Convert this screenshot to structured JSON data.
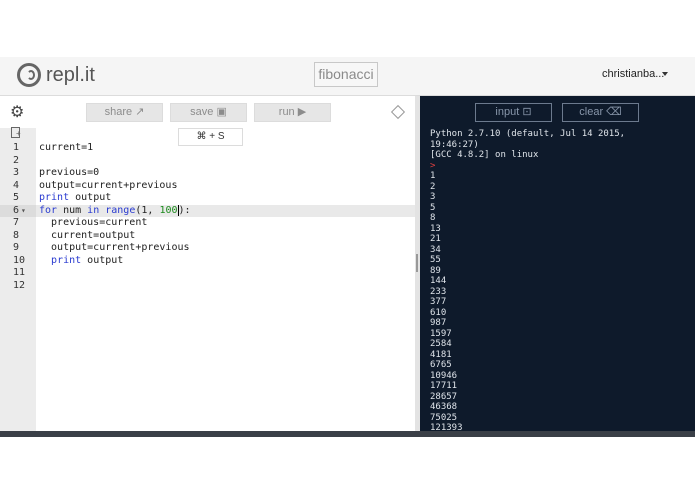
{
  "header": {
    "logo_text": "repl.it",
    "project_name": "fibonacci",
    "user_name": "christianba..."
  },
  "toolbar": {
    "share_label": "share",
    "save_label": "save",
    "run_label": "run",
    "shortcut_tip": "⌘ + S"
  },
  "editor": {
    "line_numbers": [
      "1",
      "2",
      "3",
      "4",
      "5",
      "6",
      "7",
      "8",
      "9",
      "10",
      "11",
      "12"
    ],
    "active_line": "6",
    "lines": {
      "l1": "current=1",
      "l3": "previous=0",
      "l4": "output=current+previous",
      "l5_kw": "print",
      "l5_rest": " output",
      "l6_kw1": "for",
      "l6_mid": " num ",
      "l6_kw2": "in",
      "l6_fn": " range",
      "l6_a": "(1, ",
      "l6_b": "100",
      "l6_c": "):",
      "l7": "  previous=current",
      "l8": "  current=output",
      "l9": "  output=current+previous",
      "l10_kw": "print",
      "l10_rest": " output"
    }
  },
  "console": {
    "input_label": "input",
    "clear_label": "clear",
    "banner": "Python 2.7.10 (default, Jul 14 2015,\n19:46:27)\n[GCC 4.8.2] on linux",
    "prompt": ">",
    "output": [
      "1",
      "2",
      "3",
      "5",
      "8",
      "13",
      "21",
      "34",
      "55",
      "89",
      "144",
      "233",
      "377",
      "610",
      "987",
      "1597",
      "2584",
      "4181",
      "6765",
      "10946",
      "17711",
      "28657",
      "46368",
      "75025",
      "121393"
    ]
  },
  "colors": {
    "console_bg": "#0e1a2b",
    "keyword": "#2a3bd0",
    "number": "#1b8a1b",
    "prompt": "#e04040"
  }
}
